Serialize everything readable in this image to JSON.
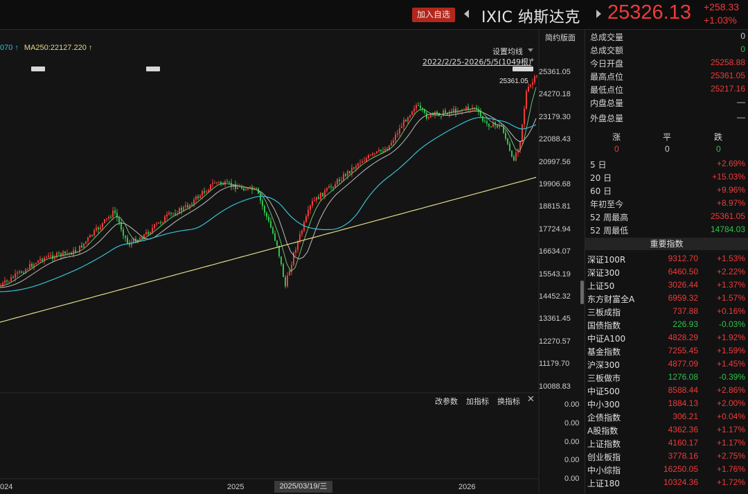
{
  "header": {
    "add_button": "加入自选",
    "symbol_title": "IXIC 纳斯达克",
    "price": "25326.13",
    "change_abs": "+258.33",
    "change_pct": "+1.03%"
  },
  "chart": {
    "ma_legend_1": "070 ↑",
    "ma_legend_2": "MA250:22127.220 ↑",
    "simple_tab": "简约版面",
    "set_ma": "设置均线",
    "range": "2022/2/25-2026/5/5(1049根)",
    "high_label": "25361.05",
    "y_ticks": [
      "25361.05",
      "24270.18",
      "23179.30",
      "22088.43",
      "20997.56",
      "19906.68",
      "18815.81",
      "17724.94",
      "16634.07",
      "15543.19",
      "14452.32",
      "13361.45",
      "12270.57",
      "11179.70",
      "10088.83"
    ],
    "sub_ticks": [
      "0.00",
      "0.00",
      "0.00",
      "0.00",
      "0.00"
    ],
    "sub_toolbar": {
      "edit_params": "改参数",
      "add_indicator": "加指标",
      "swap_indicator": "换指标"
    },
    "x_labels": [
      "024",
      "2025",
      "2026"
    ],
    "cursor_date": "2025/03/19/三",
    "colors": {
      "up": "#ef3b3b",
      "down": "#2fc24c",
      "ma_cyan": "#37c2d8",
      "ma_yellow": "#e3dc8c"
    }
  },
  "stats": [
    {
      "label": "总成交量",
      "value": "0",
      "color": "gray"
    },
    {
      "label": "总成交额",
      "value": "0",
      "color": "green"
    },
    {
      "label": "今日开盘",
      "value": "25258.88",
      "color": "red"
    },
    {
      "label": "最高点位",
      "value": "25361.05",
      "color": "red"
    },
    {
      "label": "最低点位",
      "value": "25217.16",
      "color": "red"
    },
    {
      "label": "内盘总量",
      "value": "—",
      "color": "gray"
    },
    {
      "label": "外盘总量",
      "value": "—",
      "color": "gray"
    }
  ],
  "breadth": {
    "up_label": "涨",
    "flat_label": "平",
    "down_label": "跌",
    "up": "0",
    "flat": "0",
    "down": "0"
  },
  "periods": [
    {
      "label": "5 日",
      "value": "+2.69%"
    },
    {
      "label": "20 日",
      "value": "+15.03%"
    },
    {
      "label": "60 日",
      "value": "+9.96%"
    },
    {
      "label": "年初至今",
      "value": "+8.97%"
    },
    {
      "label": "52 周最高",
      "value": "25361.05"
    },
    {
      "label": "52 周最低",
      "value": "14784.03"
    }
  ],
  "indices_header": "重要指数",
  "indices": [
    {
      "name": "深证100R",
      "price": "9312.70",
      "chg": "+1.53%",
      "color": "red"
    },
    {
      "name": "深证300",
      "price": "6460.50",
      "chg": "+2.22%",
      "color": "red"
    },
    {
      "name": "上证50",
      "price": "3026.44",
      "chg": "+1.37%",
      "color": "red"
    },
    {
      "name": "东方财富全A",
      "price": "6959.32",
      "chg": "+1.57%",
      "color": "red"
    },
    {
      "name": "三板成指",
      "price": "737.88",
      "chg": "+0.16%",
      "color": "red"
    },
    {
      "name": "国债指数",
      "price": "226.93",
      "chg": "-0.03%",
      "color": "green"
    },
    {
      "name": "中证A100",
      "price": "4828.29",
      "chg": "+1.92%",
      "color": "red"
    },
    {
      "name": "基金指数",
      "price": "7255.45",
      "chg": "+1.59%",
      "color": "red"
    },
    {
      "name": "沪深300",
      "price": "4877.09",
      "chg": "+1.45%",
      "color": "red"
    },
    {
      "name": "三板做市",
      "price": "1276.08",
      "chg": "-0.39%",
      "color": "green"
    },
    {
      "name": "中证500",
      "price": "8588.44",
      "chg": "+2.86%",
      "color": "red"
    },
    {
      "name": "中小300",
      "price": "1884.13",
      "chg": "+2.00%",
      "color": "red"
    },
    {
      "name": "企债指数",
      "price": "306.21",
      "chg": "+0.04%",
      "color": "red"
    },
    {
      "name": "A股指数",
      "price": "4362.36",
      "chg": "+1.17%",
      "color": "red"
    },
    {
      "name": "上证指数",
      "price": "4160.17",
      "chg": "+1.17%",
      "color": "red"
    },
    {
      "name": "创业板指",
      "price": "3778.16",
      "chg": "+2.75%",
      "color": "red"
    },
    {
      "name": "中小综指",
      "price": "16250.05",
      "chg": "+1.76%",
      "color": "red"
    },
    {
      "name": "上证180",
      "price": "10324.36",
      "chg": "+1.72%",
      "color": "red"
    }
  ]
}
